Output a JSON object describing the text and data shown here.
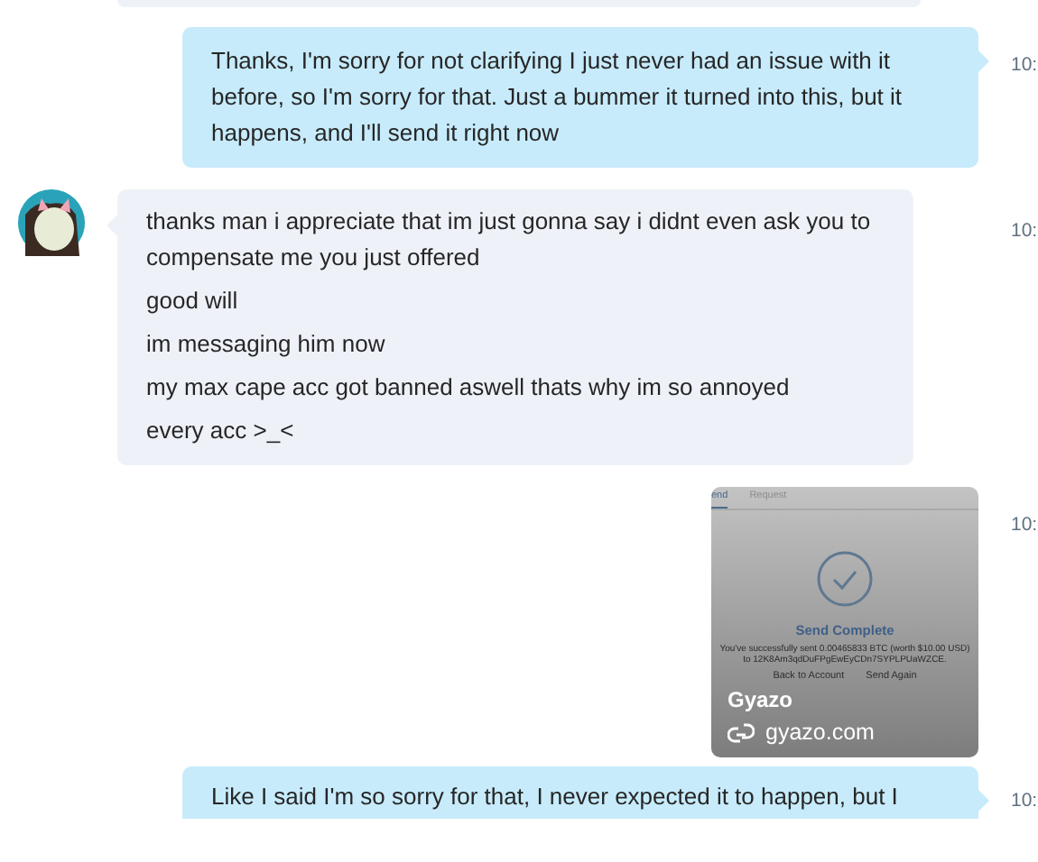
{
  "messages": [
    {
      "kind": "incoming-end"
    },
    {
      "kind": "outgoing",
      "time": "10:",
      "paragraphs": [
        "Thanks, I'm sorry for not clarifying I just never had an issue with it before, so I'm sorry for that. Just a bummer it turned into this, but it happens, and I'll send it right now"
      ]
    },
    {
      "kind": "incoming",
      "time": "10:",
      "paragraphs": [
        "thanks man i appreciate that im just gonna say i didnt even ask you to compensate me you just offered",
        "good will",
        "im messaging him now",
        "my max cape acc got banned aswell thats why im so annoyed",
        "every acc >_<"
      ]
    },
    {
      "kind": "image",
      "time": "10:",
      "preview": {
        "tabs": [
          {
            "label": "end",
            "selected": true
          },
          {
            "label": "Request",
            "selected": false
          }
        ],
        "heading": "Send Complete",
        "detail": "You've successfully sent 0.00465833 BTC (worth $10.00 USD) to 12K8Am3qdDuFPgEwEyCDn7SYPLPUaWZCE.",
        "actions": [
          "Back to Account",
          "Send Again"
        ]
      },
      "site": "Gyazo",
      "domain": "gyazo.com"
    },
    {
      "kind": "outgoing",
      "time": "10:",
      "paragraphs": [
        "Like I said I'm so sorry for that, I never expected it to happen, but I"
      ]
    }
  ]
}
